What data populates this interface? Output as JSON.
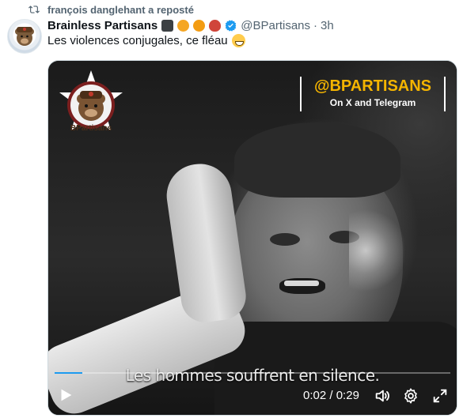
{
  "repost": {
    "text": "françois danglehant a reposté",
    "icon": "repost-icon"
  },
  "tweet": {
    "author_name": "Brainless Partisans",
    "author_emojis": [
      "skull-flag-emoji",
      "radioactive-emoji",
      "biohazard-emoji",
      "bomb-emoji"
    ],
    "verified_icon": "verified-badge-icon",
    "handle": "@BPartisans",
    "dot": "·",
    "time": "3h",
    "text": "Les violences conjugales, ce fléau",
    "text_emoji": "grinning-face-emoji"
  },
  "video": {
    "logo_text": "BPartisans",
    "brand_title": "@BPARTISANS",
    "brand_subtitle": "On X and Telegram",
    "subtitle": "Les hommes souffrent en silence.",
    "progress": 0.069,
    "current_time": "0:02",
    "separator": "/",
    "duration": "0:29",
    "icons": [
      "play-icon",
      "volume-icon",
      "settings-icon",
      "fullscreen-icon"
    ]
  },
  "colors": {
    "accent": "#1d9bf0",
    "brand_gold": "#f4b400",
    "muted": "#536471",
    "text": "#0f1419"
  }
}
